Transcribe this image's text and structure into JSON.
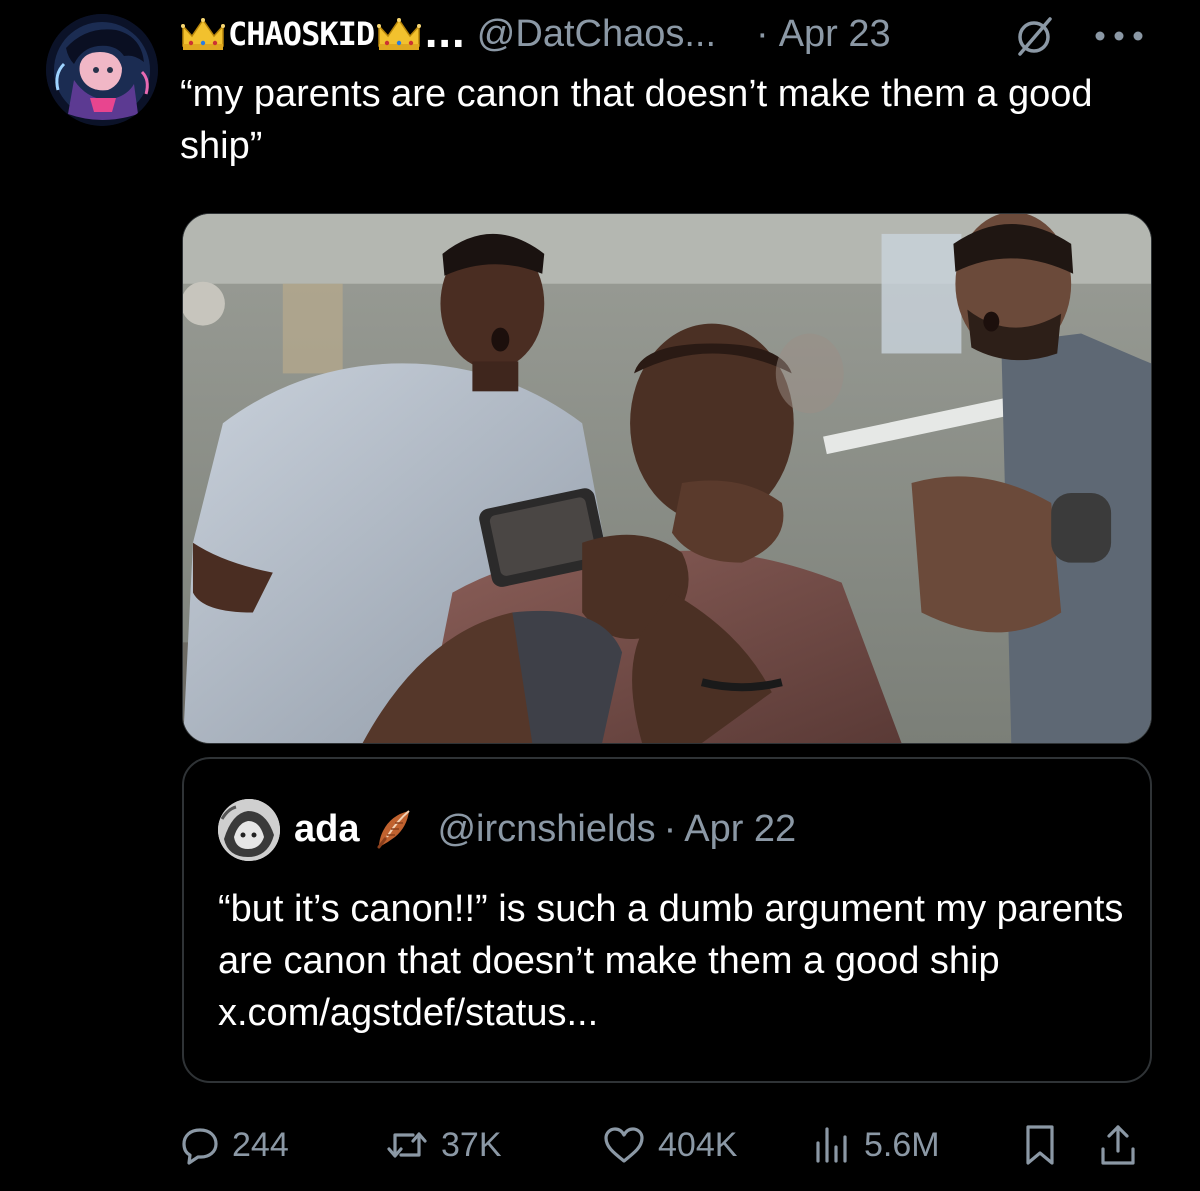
{
  "post": {
    "author": {
      "name_text": "CHAOSKID",
      "name_ellipsis": "...",
      "handle": "@DatChaos...",
      "avatar_icon": "avatar-anime-character-icon"
    },
    "separator": "·",
    "date": "Apr 23",
    "text": "“my parents are canon that doesn’t make them a good ship”",
    "media_icon": "photo-barbershop-phone-scene"
  },
  "quote": {
    "name": "ada",
    "handle": "@ircnshields",
    "separator": "·",
    "date": "Apr 22",
    "text": "“but it’s canon!!” is such a dumb argument my parents are canon that doesn’t make them a good ship x.com/agstdef/status..."
  },
  "actions": {
    "replies": "244",
    "reposts": "37K",
    "likes": "404K",
    "views": "5.6M"
  },
  "colors": {
    "background": "#000000",
    "text": "#ffffff",
    "muted": "#8b98a5",
    "border": "#2f3336"
  }
}
